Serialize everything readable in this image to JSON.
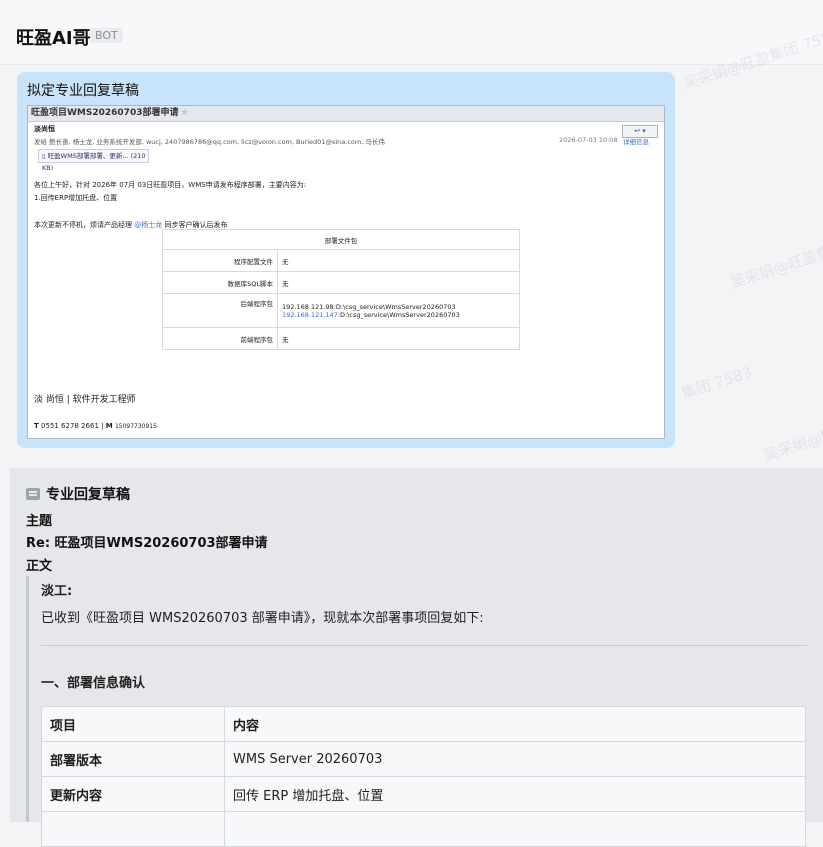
{
  "header": {
    "bot_name": "旺盈AI哥",
    "bot_tag": "BOT"
  },
  "watermarks": [
    "吴采娟@旺盈集团 7583",
    "吴采娟@旺盈集团",
    "集团 7583",
    "吴采娟@旺盈集团 7583"
  ],
  "user_message": {
    "text": "拟定专业回复草稿",
    "email_screenshot": {
      "subject": "旺盈项目WMS20260703部署申请",
      "sender": "淡尚恒",
      "recipients": "发给 鲍长善, 杨士龙, 业务系统开发部, wucj, 2407986786@qq.com, licz@voion.com, Buried01@sina.com, 马长伟",
      "date": "2026-07-03 10:08",
      "details_link": "详细信息",
      "attachment": "旺盈WMS部署部署、更新...  (210 KB)",
      "greeting": "各位上午好，针对 2026年 07月 03日旺盈项目，WMS申请发布程序部署，主要内容为:",
      "item1": "1.回传ERP增加托盘、位置",
      "note_prefix": "本次更新不停机，烦请产品经理",
      "note_mention": "@杨士龙",
      "note_suffix": "同步客户确认后发布",
      "table_header": "部署文件包",
      "rows": [
        {
          "label": "程序配置文件",
          "value": "无"
        },
        {
          "label": "数据库SQL脚本",
          "value": "无"
        },
        {
          "label": "后端程序包",
          "value": "192.168.121.98:D:\\csg_service\\WmsServer20260703",
          "ip2": "192.168.121.147",
          "value2": ":D:\\csg_service\\WmsServer20260703"
        },
        {
          "label": "前端程序包",
          "value": "无"
        }
      ],
      "signature_name": "淡  尚恒  |  软件开发工程师",
      "signature_phone_label": "T",
      "signature_phone": "0551 6278 2661",
      "signature_mobile_label": "M",
      "signature_mobile": "15097730915"
    }
  },
  "reply": {
    "title": "专业回复草稿",
    "subject_label": "主题",
    "subject_value": "Re: 旺盈项目WMS20260703部署申请",
    "body_label": "正文",
    "greeting": "淡工:",
    "intro": "已收到《旺盈项目 WMS20260703 部署申请》，现就本次部署事项回复如下:",
    "section1": "一、部署信息确认",
    "table": {
      "headers": [
        "项目",
        "内容"
      ],
      "rows": [
        [
          "部署版本",
          "WMS Server 20260703"
        ],
        [
          "更新内容",
          "回传 ERP 增加托盘、位置"
        ]
      ]
    }
  }
}
